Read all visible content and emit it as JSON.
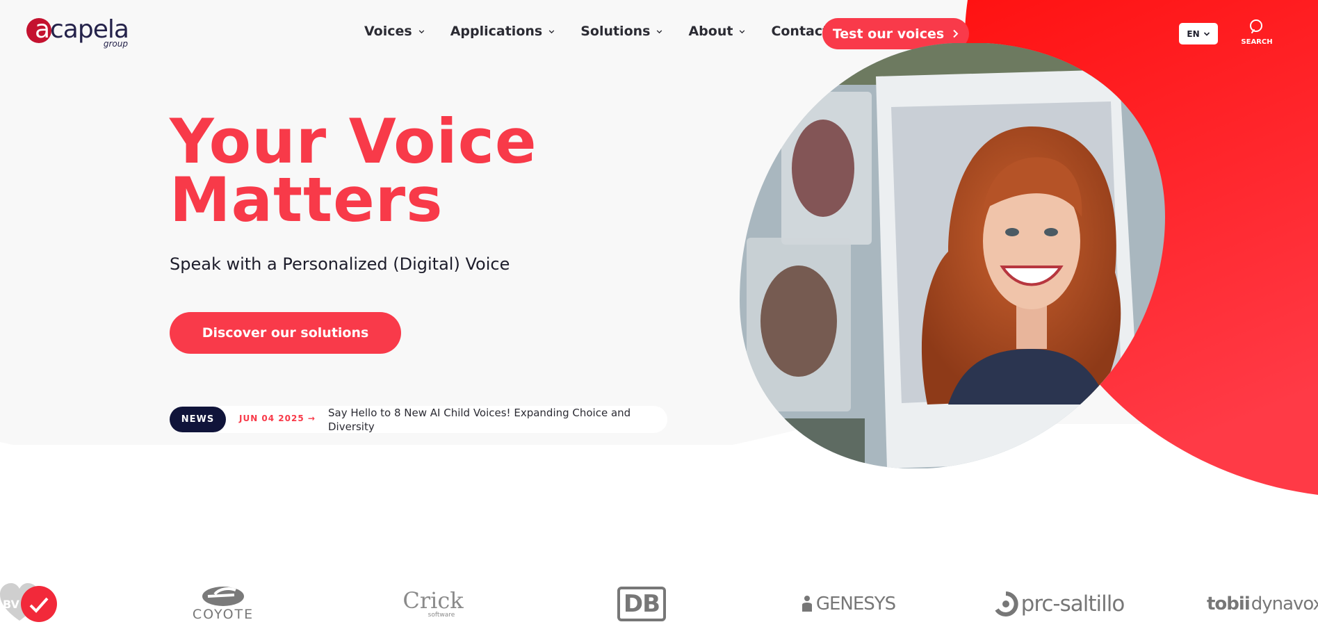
{
  "brand": {
    "logo_letter": "a",
    "logo_word": "capela",
    "logo_sub": "group",
    "accent": "#f93a4a",
    "red_shape": "#ff1a1a",
    "dark_navy": "#10143a"
  },
  "nav": {
    "items": [
      {
        "label": "Voices",
        "dropdown": true
      },
      {
        "label": "Applications",
        "dropdown": true
      },
      {
        "label": "Solutions",
        "dropdown": true
      },
      {
        "label": "About",
        "dropdown": true
      },
      {
        "label": "Contact",
        "dropdown": false
      }
    ],
    "cta_label": "Test our voices",
    "language": "EN",
    "search_label": "SEARCH"
  },
  "hero": {
    "title_line1": "Your Voice",
    "title_line2": "Matters",
    "subtitle": "Speak with a Personalized (Digital) Voice",
    "cta_label": "Discover our solutions",
    "image_icon": "smiling-woman-photo"
  },
  "news": {
    "badge": "NEWS",
    "date": "JUN 04 2025 →",
    "headline": "Say Hello to 8 New AI Child Voices! Expanding Choice and Diversity"
  },
  "partners": [
    {
      "name": "BV",
      "icon": "bv-heart-logo"
    },
    {
      "name": "COYOTE",
      "icon": "coyote-logo"
    },
    {
      "name": "Crick",
      "sub": "software",
      "icon": "crick-logo"
    },
    {
      "name": "DB",
      "icon": "db-logo"
    },
    {
      "name": "GENESYS",
      "icon": "genesys-logo"
    },
    {
      "name": "prc-saltillo",
      "icon": "prc-saltillo-logo"
    },
    {
      "name": "tobii",
      "sub": "dynavox",
      "icon": "tobii-dynavox-logo"
    }
  ]
}
